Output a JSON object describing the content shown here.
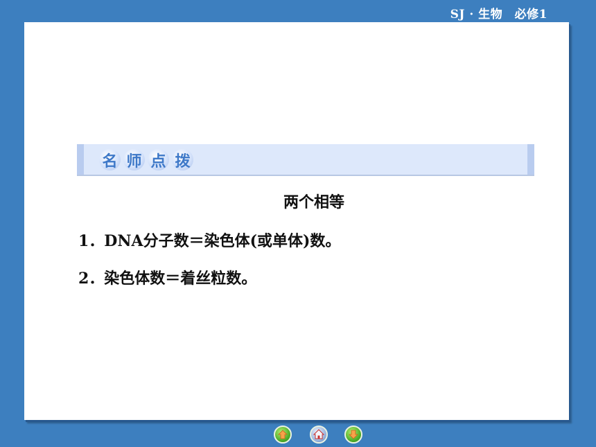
{
  "header": {
    "course_label": "SJ · 生物　必修1"
  },
  "banner": {
    "chips": [
      "名",
      "师",
      "点",
      "拨"
    ]
  },
  "content": {
    "subtitle": "两个相等",
    "items": [
      "1．DNA分子数＝染色体(或单体)数。",
      "2．染色体数＝着丝粒数。"
    ]
  },
  "nav": {
    "prev_icon": "arrow-up-circle-icon",
    "home_icon": "home-icon",
    "next_icon": "arrow-down-circle-icon"
  },
  "colors": {
    "background": "#3d7fbf",
    "banner": "#dde8fb",
    "chip_text": "#3d78c8",
    "nav_green": "#4fb02b"
  }
}
